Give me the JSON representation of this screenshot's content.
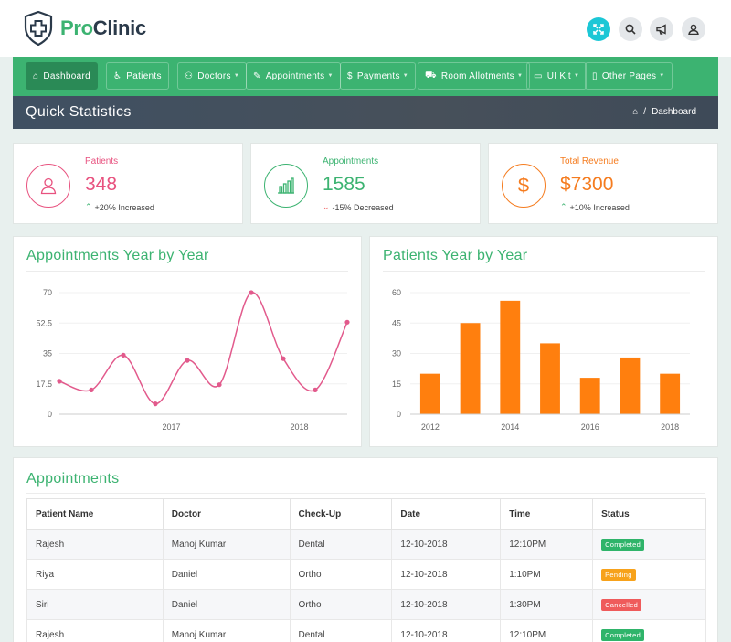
{
  "brand": {
    "pro": "Pro",
    "clinic": "Clinic"
  },
  "header_icons": [
    "fullscreen-icon",
    "search-icon",
    "megaphone-icon",
    "user-icon"
  ],
  "nav": [
    {
      "label": "Dashboard",
      "icon": "home-icon",
      "active": true
    },
    {
      "label": "Patients",
      "icon": "wheelchair-icon"
    },
    {
      "label": "Doctors",
      "icon": "user-icon"
    },
    {
      "label": "Appointments",
      "icon": "edit-icon"
    },
    {
      "label": "Payments",
      "icon": "dollar-icon"
    },
    {
      "label": "Room Allotments",
      "icon": "bed-icon"
    },
    {
      "label": "UI Kit",
      "icon": "folder-icon"
    },
    {
      "label": "Other Pages",
      "icon": "file-icon"
    }
  ],
  "page_title": "Quick Statistics",
  "breadcrumb": {
    "current": "Dashboard"
  },
  "stats": [
    {
      "label": "Patients",
      "value": "348",
      "change": "+20% Increased",
      "direction": "up",
      "color": "#e8527f"
    },
    {
      "label": "Appointments",
      "value": "1585",
      "change": "-15% Decreased",
      "direction": "down",
      "color": "#3cb371"
    },
    {
      "label": "Total Revenue",
      "value": "$7300",
      "change": "+10% Increased",
      "direction": "up",
      "color": "#f57c1f"
    }
  ],
  "colors": {
    "accent": "#3cb371",
    "up": "#3cb371",
    "down": "#ef4f4f",
    "line": "#e25a8c",
    "bar": "#ff7f0e"
  },
  "chart_data": [
    {
      "type": "line",
      "title": "Appointments Year by Year",
      "x_tick_labels": [
        "2017",
        "2018"
      ],
      "x_tick_positions": [
        3.5,
        7.5
      ],
      "values": [
        19,
        14,
        34,
        6,
        31,
        17,
        70,
        32,
        14,
        53
      ],
      "ylim": [
        0,
        70
      ],
      "yticks": [
        "0",
        "17.5",
        "35",
        "52.5",
        "70"
      ],
      "grid": true
    },
    {
      "type": "bar",
      "title": "Patients Year by Year",
      "categories": [
        "2012",
        "2013",
        "2014",
        "2015",
        "2016",
        "2017",
        "2018"
      ],
      "x_tick_labels": [
        "2012",
        "2014",
        "2016",
        "2018"
      ],
      "values": [
        20,
        45,
        56,
        35,
        18,
        28,
        20
      ],
      "ylim": [
        0,
        60
      ],
      "yticks": [
        "0",
        "15",
        "30",
        "45",
        "60"
      ],
      "grid": true
    }
  ],
  "appointments": {
    "title": "Appointments",
    "columns": [
      "Patient Name",
      "Doctor",
      "Check-Up",
      "Date",
      "Time",
      "Status"
    ],
    "rows": [
      {
        "patient": "Rajesh",
        "doctor": "Manoj Kumar",
        "checkup": "Dental",
        "date": "12-10-2018",
        "time": "12:10PM",
        "status": "Completed"
      },
      {
        "patient": "Riya",
        "doctor": "Daniel",
        "checkup": "Ortho",
        "date": "12-10-2018",
        "time": "1:10PM",
        "status": "Pending"
      },
      {
        "patient": "Siri",
        "doctor": "Daniel",
        "checkup": "Ortho",
        "date": "12-10-2018",
        "time": "1:30PM",
        "status": "Cancelled"
      },
      {
        "patient": "Rajesh",
        "doctor": "Manoj Kumar",
        "checkup": "Dental",
        "date": "12-10-2018",
        "time": "12:10PM",
        "status": "Completed"
      }
    ]
  }
}
